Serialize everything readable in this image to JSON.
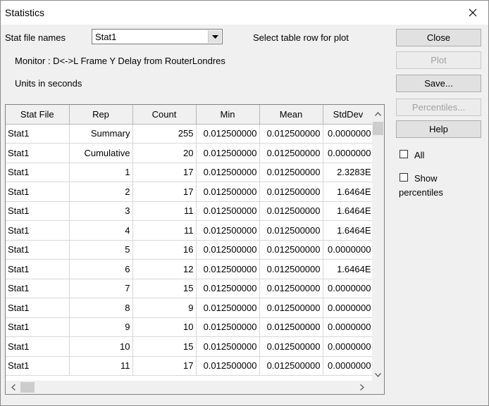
{
  "window": {
    "title": "Statistics"
  },
  "stat_file_names_label": "Stat file names",
  "stat_file_select": {
    "value": "Stat1"
  },
  "select_row_hint": "Select table row for plot",
  "monitor_text": "Monitor : D<->L Frame Y Delay from RouterLondres",
  "units_text": "Units in seconds",
  "buttons": {
    "close": "Close",
    "plot": "Plot",
    "save": "Save...",
    "percentiles": "Percentiles...",
    "help": "Help"
  },
  "checkboxes": {
    "all": {
      "label": "All",
      "checked": false
    },
    "show_percentiles": {
      "label_line1": "Show",
      "label_line2": "percentiles",
      "checked": false
    }
  },
  "table": {
    "columns": [
      "Stat File",
      "Rep",
      "Count",
      "Min",
      "Mean",
      "StdDev"
    ],
    "rows": [
      [
        "Stat1",
        "Summary",
        "255",
        "0.012500000",
        "0.012500000",
        "0.0000000"
      ],
      [
        "Stat1",
        "Cumulative",
        "20",
        "0.012500000",
        "0.012500000",
        "0.0000000"
      ],
      [
        "Stat1",
        "1",
        "17",
        "0.012500000",
        "0.012500000",
        "2.3283E"
      ],
      [
        "Stat1",
        "2",
        "17",
        "0.012500000",
        "0.012500000",
        "1.6464E"
      ],
      [
        "Stat1",
        "3",
        "11",
        "0.012500000",
        "0.012500000",
        "1.6464E"
      ],
      [
        "Stat1",
        "4",
        "11",
        "0.012500000",
        "0.012500000",
        "1.6464E"
      ],
      [
        "Stat1",
        "5",
        "16",
        "0.012500000",
        "0.012500000",
        "0.0000000"
      ],
      [
        "Stat1",
        "6",
        "12",
        "0.012500000",
        "0.012500000",
        "1.6464E"
      ],
      [
        "Stat1",
        "7",
        "15",
        "0.012500000",
        "0.012500000",
        "0.0000000"
      ],
      [
        "Stat1",
        "8",
        "9",
        "0.012500000",
        "0.012500000",
        "0.0000000"
      ],
      [
        "Stat1",
        "9",
        "10",
        "0.012500000",
        "0.012500000",
        "0.0000000"
      ],
      [
        "Stat1",
        "10",
        "15",
        "0.012500000",
        "0.012500000",
        "0.0000000"
      ],
      [
        "Stat1",
        "11",
        "17",
        "0.012500000",
        "0.012500000",
        "0.0000000"
      ]
    ]
  }
}
